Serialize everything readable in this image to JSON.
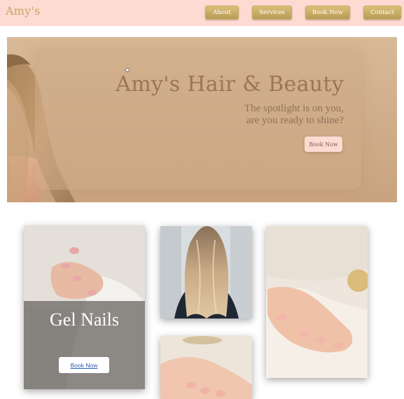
{
  "header": {
    "logo": "Amy's",
    "nav": [
      {
        "label": "About"
      },
      {
        "label": "Services"
      },
      {
        "label": "Book Now"
      },
      {
        "label": "Contact"
      }
    ]
  },
  "hero": {
    "title": "Amy's Hair & Beauty",
    "subtitle_line1": "The spotlight is on you,",
    "subtitle_line2": "are you ready to shine?",
    "button": "Book Now"
  },
  "services": {
    "gel": {
      "title": "Gel Nails",
      "button": "Book Now"
    }
  },
  "colors": {
    "header_bg": "#fddad2",
    "gold": "#c9a561",
    "hero_bg": "#d2b18e",
    "hero_text": "#9a7657"
  }
}
